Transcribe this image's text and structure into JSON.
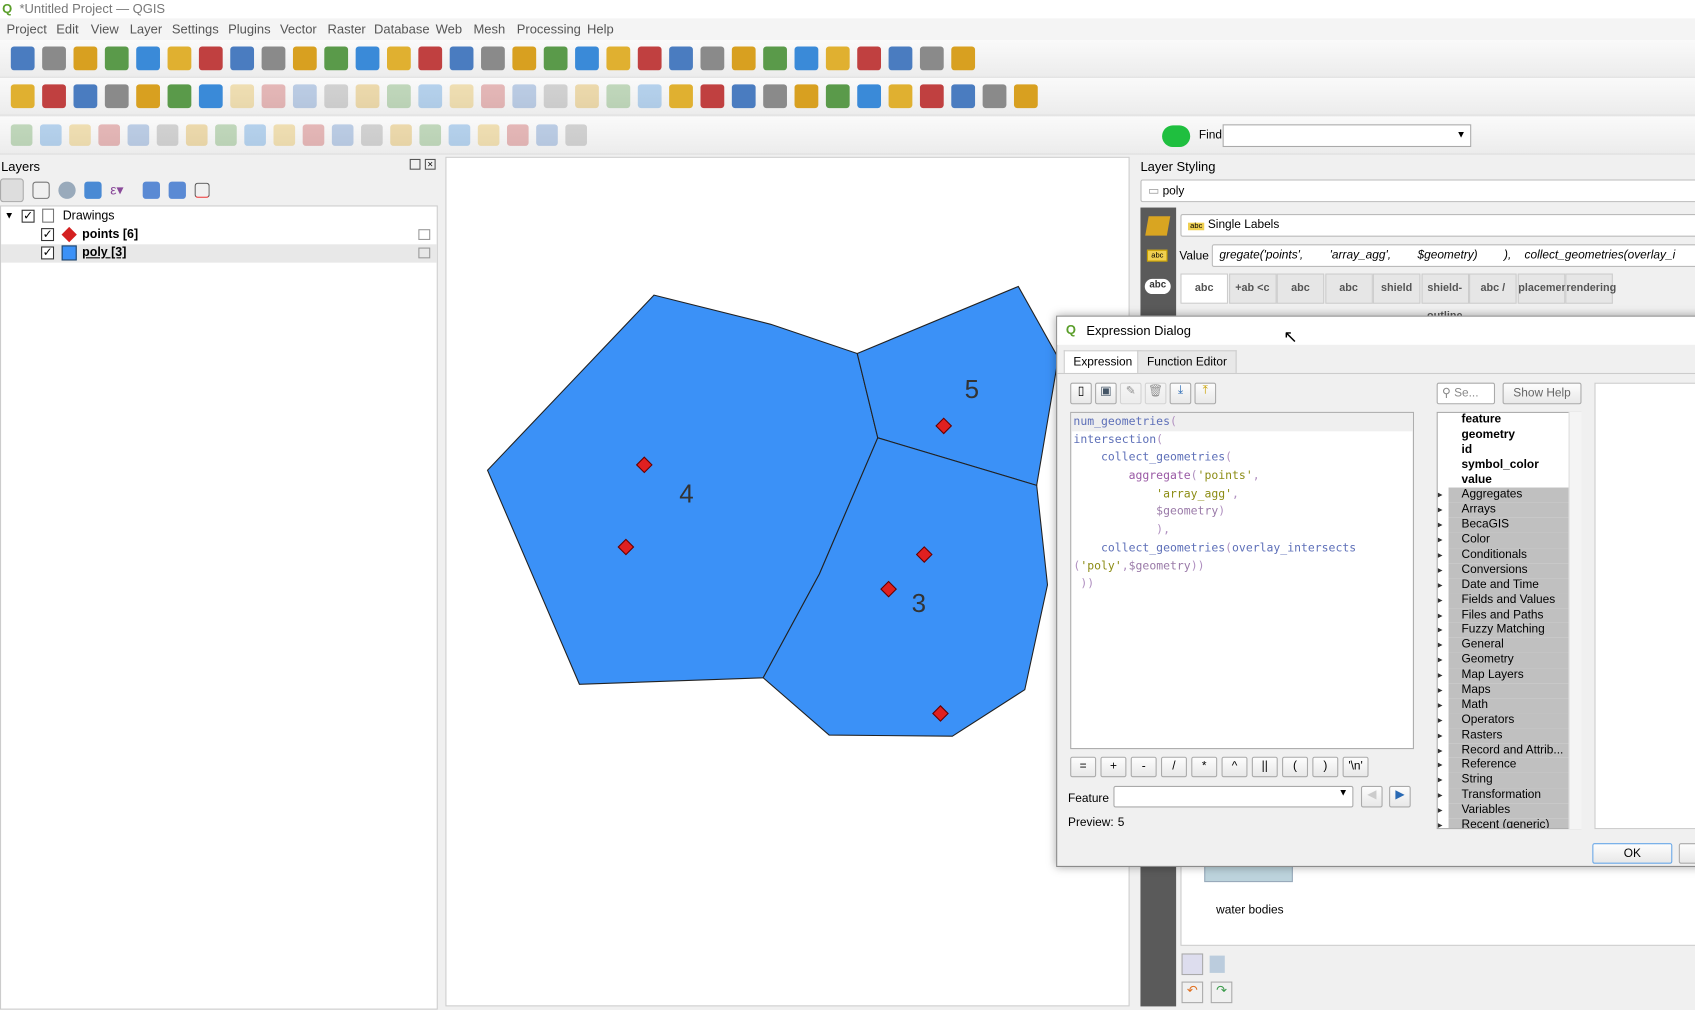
{
  "window": {
    "title": "*Untitled Project — QGIS",
    "app_icon": "qgis-logo-icon"
  },
  "menu": [
    "Project",
    "Edit",
    "View",
    "Layer",
    "Settings",
    "Plugins",
    "Vector",
    "Raster",
    "Database",
    "Web",
    "Mesh",
    "Processing",
    "Help"
  ],
  "toolbars": [
    [
      "new-project",
      "open-project",
      "save-project",
      "new-print-layout",
      "layout-manager",
      "style-manager",
      "pan",
      "pan-to-selection",
      "zoom-in",
      "zoom-out",
      "zoom-full",
      "zoom-to-selection",
      "zoom-to-layer",
      "zoom-native",
      "zoom-last",
      "zoom-next",
      "new-bookmark",
      "show-bookmarks",
      "temporal",
      "refresh",
      "select-features",
      "select-by-value",
      "deselect",
      "identify",
      "attribute-table",
      "field-calculator",
      "statistics",
      "measure",
      "map-tips",
      "python-console",
      "settings-gear"
    ],
    [
      "data-source-manager",
      "new-geopackage",
      "new-shapefile",
      "new-spatialite",
      "new-virtual",
      "new-mesh",
      "new-temp-layer",
      "toggle-editing",
      "pencil",
      "save-edits",
      "digitize-line",
      "add-polygon",
      "add-feature",
      "vertex-tool",
      "modify-attributes",
      "delete-selected",
      "cut",
      "copy",
      "paste",
      "undo",
      "redo",
      "label-abc",
      "label-pin",
      "label-show",
      "label-move",
      "label-rotate",
      "label-change",
      "plugin-hex",
      "plugin-globe",
      "plugin-binoculars",
      "python",
      "plugin-color",
      "plugin-more"
    ],
    [
      "advanced-digitizing",
      "move-feature",
      "rotate",
      "simplify",
      "add-ring",
      "add-part",
      "fill-ring",
      "delete-ring",
      "delete-part",
      "reshape",
      "offset-curve",
      "split-features",
      "split-parts",
      "merge-attributes",
      "merge-features",
      "rotate-point-symbols",
      "trim-extend",
      "copy-paste",
      "coordinate-capture",
      "osm-plugin"
    ]
  ],
  "locator": {
    "label": "Find",
    "value": ""
  },
  "layers_panel": {
    "title": "Layers",
    "group": "Drawings",
    "layers": [
      {
        "name": "points [6]",
        "symbol": "red-diamond",
        "checked": true
      },
      {
        "name": "poly [3]",
        "symbol": "blue-square",
        "checked": true,
        "selected": true
      }
    ]
  },
  "map": {
    "fill_color": "#3b91f7",
    "point_color": "#e02020",
    "labels": [
      "4",
      "5",
      "3"
    ]
  },
  "styling": {
    "title": "Layer Styling",
    "layer": "poly",
    "mode": "Single Labels",
    "value_label": "Value",
    "value": "gregate('points',        'array_agg',        $geometry)        ),    collect_geometries(overlay_i",
    "tabs": [
      "abc",
      "+ab <c",
      "abc",
      "abc",
      "shield",
      "shield-outline",
      "abc /",
      "placement",
      "rendering"
    ],
    "preview_text": "water bodies"
  },
  "dialog": {
    "title": "Expression Dialog",
    "tabs": [
      "Expression",
      "Function Editor"
    ],
    "search_placeholder": "Se...",
    "show_help": "Show Help",
    "code": [
      [
        [
          "fn",
          "num_geometries"
        ],
        [
          "pn",
          "("
        ]
      ],
      [
        [
          "fn",
          "intersection"
        ],
        [
          "pn",
          "("
        ]
      ],
      [
        [
          "",
          "    "
        ],
        [
          "fn",
          "collect_geometries"
        ],
        [
          "pn",
          "("
        ]
      ],
      [
        [
          "",
          "        "
        ],
        [
          "pu",
          "aggregate"
        ],
        [
          "pn",
          "("
        ],
        [
          "st",
          "'points'"
        ],
        [
          "pn",
          ","
        ]
      ],
      [
        [
          "",
          "            "
        ],
        [
          "st",
          "'array_agg'"
        ],
        [
          "pn",
          ","
        ]
      ],
      [
        [
          "",
          "            "
        ],
        [
          "vr",
          "$geometry"
        ],
        [
          "pn",
          ")"
        ]
      ],
      [
        [
          "",
          "            "
        ],
        [
          "pn",
          "),"
        ]
      ],
      [
        [
          "",
          "    "
        ],
        [
          "fn",
          "collect_geometries"
        ],
        [
          "pn",
          "("
        ],
        [
          "fn",
          "overlay_intersects"
        ]
      ],
      [
        [
          "pn",
          "("
        ],
        [
          "st",
          "'poly'"
        ],
        [
          "pn",
          ","
        ],
        [
          "vr",
          "$geometry"
        ],
        [
          "pn",
          "))"
        ]
      ],
      [
        [
          "pn",
          " ))"
        ]
      ]
    ],
    "fields": [
      "feature",
      "geometry",
      "id",
      "symbol_color",
      "value"
    ],
    "groups": [
      "Aggregates",
      "Arrays",
      "BecaGIS",
      "Color",
      "Conditionals",
      "Conversions",
      "Date and Time",
      "Fields and Values",
      "Files and Paths",
      "Fuzzy Matching",
      "General",
      "Geometry",
      "Map Layers",
      "Maps",
      "Math",
      "Operators",
      "Rasters",
      "Record and Attrib...",
      "Reference",
      "String",
      "Transformation",
      "Variables",
      "Recent (generic)"
    ],
    "operators": [
      "=",
      "+",
      "-",
      "/",
      "*",
      "^",
      "||",
      "(",
      ")",
      "'\\n'"
    ],
    "feature_label": "Feature",
    "feature_value": "",
    "preview_label": "Preview:",
    "preview_value": "5",
    "ok": "OK"
  }
}
